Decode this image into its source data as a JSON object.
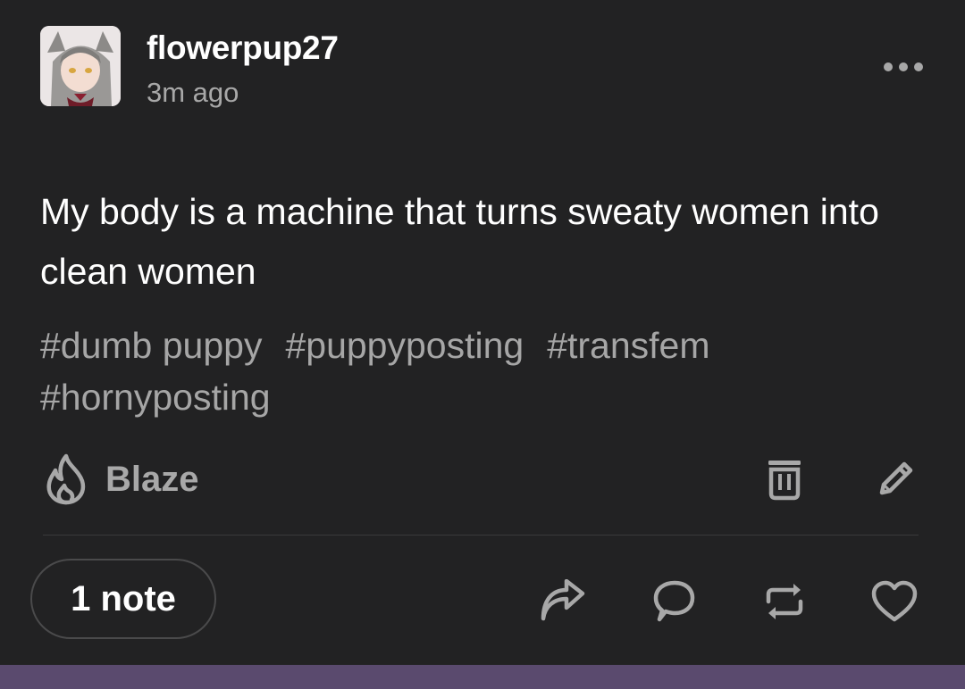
{
  "post": {
    "username": "flowerpup27",
    "timestamp": "3m ago",
    "body_text": "My body is a machine that turns sweaty women into clean women",
    "tags": [
      "#dumb puppy",
      "#puppyposting",
      "#transfem",
      "#hornyposting"
    ],
    "notes_label": "1 note"
  },
  "actions": {
    "blaze_label": "Blaze",
    "top_icons": [
      "delete-icon",
      "edit-icon"
    ],
    "bottom_icons": [
      "share-icon",
      "reply-icon",
      "reblog-icon",
      "like-icon"
    ]
  },
  "colors": {
    "background": "#222223",
    "muted_text": "#a8a8a8",
    "bottom_bar": "#5a4a6e"
  }
}
